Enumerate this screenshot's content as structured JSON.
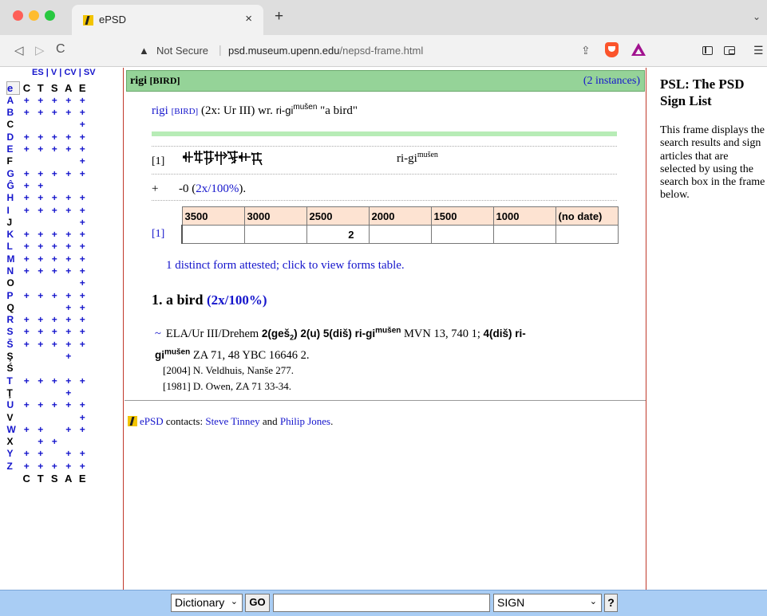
{
  "browser": {
    "tab_title": "ePSD",
    "tab_close": "×",
    "new_tab": "+",
    "tab_menu": "⌄",
    "nav_back": "◁",
    "nav_forward": "▷",
    "nav_reload": "C",
    "security_label": "Not Secure",
    "url_host": "psd.museum.upenn.edu",
    "url_path": "/nepsd-frame.html",
    "colors": {
      "tab_bar": "#dedede",
      "toolbar": "#f2f2f2"
    }
  },
  "index": {
    "head": {
      "es": "ES",
      "v": "V",
      "cv": "CV",
      "sv": "SV",
      "sep": "|"
    },
    "columns": [
      "C",
      "T",
      "S",
      "A",
      "E"
    ],
    "selected": "e",
    "rows": [
      {
        "letter": "A",
        "marks": [
          "+",
          "+",
          "+",
          "+",
          "+"
        ]
      },
      {
        "letter": "B",
        "marks": [
          "+",
          "+",
          "+",
          "+",
          "+"
        ]
      },
      {
        "letter": "C",
        "marks": [
          "",
          "",
          "",
          "",
          "+"
        ]
      },
      {
        "letter": "D",
        "marks": [
          "+",
          "+",
          "+",
          "+",
          "+"
        ]
      },
      {
        "letter": "E",
        "marks": [
          "+",
          "+",
          "+",
          "+",
          "+"
        ]
      },
      {
        "letter": "F",
        "marks": [
          "",
          "",
          "",
          "",
          "+"
        ]
      },
      {
        "letter": "G",
        "marks": [
          "+",
          "+",
          "+",
          "+",
          "+"
        ]
      },
      {
        "letter": "Ĝ",
        "marks": [
          "+",
          "+",
          "",
          "",
          ""
        ]
      },
      {
        "letter": "H",
        "marks": [
          "+",
          "+",
          "+",
          "+",
          "+"
        ]
      },
      {
        "letter": "I",
        "marks": [
          "+",
          "+",
          "+",
          "+",
          "+"
        ]
      },
      {
        "letter": "J",
        "marks": [
          "",
          "",
          "",
          "",
          "+"
        ]
      },
      {
        "letter": "K",
        "marks": [
          "+",
          "+",
          "+",
          "+",
          "+"
        ]
      },
      {
        "letter": "L",
        "marks": [
          "+",
          "+",
          "+",
          "+",
          "+"
        ]
      },
      {
        "letter": "M",
        "marks": [
          "+",
          "+",
          "+",
          "+",
          "+"
        ]
      },
      {
        "letter": "N",
        "marks": [
          "+",
          "+",
          "+",
          "+",
          "+"
        ]
      },
      {
        "letter": "O",
        "marks": [
          "",
          "",
          "",
          "",
          "+"
        ]
      },
      {
        "letter": "P",
        "marks": [
          "+",
          "+",
          "+",
          "+",
          "+"
        ]
      },
      {
        "letter": "Q",
        "marks": [
          "",
          "",
          "",
          "+",
          "+"
        ]
      },
      {
        "letter": "R",
        "marks": [
          "+",
          "+",
          "+",
          "+",
          "+"
        ]
      },
      {
        "letter": "S",
        "marks": [
          "+",
          "+",
          "+",
          "+",
          "+"
        ]
      },
      {
        "letter": "Š",
        "marks": [
          "+",
          "+",
          "+",
          "+",
          "+"
        ]
      },
      {
        "letter": "Ş",
        "marks": [
          "",
          "",
          "",
          "+",
          ""
        ]
      },
      {
        "letter": "Ś",
        "marks": [
          "",
          "",
          "",
          "",
          ""
        ]
      },
      {
        "letter": "T",
        "marks": [
          "+",
          "+",
          "+",
          "+",
          "+"
        ]
      },
      {
        "letter": "Ţ",
        "marks": [
          "",
          "",
          "",
          "+",
          ""
        ]
      },
      {
        "letter": "U",
        "marks": [
          "+",
          "+",
          "+",
          "+",
          "+"
        ]
      },
      {
        "letter": "V",
        "marks": [
          "",
          "",
          "",
          "",
          "+"
        ]
      },
      {
        "letter": "W",
        "marks": [
          "+",
          "+",
          "",
          "+",
          "+"
        ]
      },
      {
        "letter": "X",
        "marks": [
          "",
          "+",
          "+",
          "",
          ""
        ]
      },
      {
        "letter": "Y",
        "marks": [
          "+",
          "+",
          "",
          "+",
          "+"
        ]
      },
      {
        "letter": "Z",
        "marks": [
          "+",
          "+",
          "+",
          "+",
          "+"
        ]
      }
    ],
    "plain_letters": [
      "C",
      "F",
      "J",
      "O",
      "Q",
      "Ş",
      "Ś",
      "Ţ",
      "V",
      "X"
    ],
    "colors": {
      "link": "#1515cc",
      "frame_border": "#c0392b"
    }
  },
  "entry": {
    "title_word": "rigi",
    "title_gloss": "[BIRD]",
    "instances": "(2 instances)",
    "summary_word": "rigi",
    "summary_gloss": "[BIRD]",
    "summary_mid": " (2x: Ur III) wr. ",
    "summary_form": "ri-gi",
    "summary_form_sup": "mušen",
    "summary_meaning": " \"a bird\"",
    "form_index": "[1]",
    "form_translit": "ri-gi",
    "form_translit_sup": "mušen",
    "plus_sign": "+",
    "plus_prefix": "-0 (",
    "plus_link": "2x/100%",
    "plus_suffix": ").",
    "table": {
      "headers": [
        "3500",
        "3000",
        "2500",
        "2000",
        "1500",
        "1000",
        "(no date)"
      ],
      "row_label": "[1]",
      "row_values": [
        "",
        "",
        "2",
        "",
        "",
        "",
        ""
      ]
    },
    "forms_link": "1 distinct form attested; click to view forms table.",
    "sense_label": "1. a bird",
    "sense_stats": "(2x/100%)",
    "citation": {
      "tilde": "~",
      "source": "ELA/Ur III/Drehem ",
      "b1": "2(geš",
      "b1_sub": "2",
      "b1_end": ") 2(u) 5(diš) ri-gi",
      "b1_sup": "mušen",
      "ref1": " MVN 13, 740 1; ",
      "b2a": "4(diš) ri-",
      "b2b": "gi",
      "b2_sup": "mušen",
      "ref2": " ZA 71, 48 YBC 16646 2."
    },
    "bib1": "[2004] N. Veldhuis, Nanše 277.",
    "bib2": "[1981] D. Owen, ZA 71 33-34.",
    "contacts": {
      "epsd": "ePSD",
      "label": " contacts: ",
      "person1": "Steve Tinney",
      "and": " and ",
      "person2": "Philip Jones",
      "end": "."
    },
    "colors": {
      "title_bar": "#95d398",
      "green_rule": "#b7ecb6",
      "table_header": "#fde3d2"
    }
  },
  "info": {
    "title": "PSL: The PSD Sign List",
    "description": "This frame displays the search results and sign articles that are selected by using the search box in the frame below."
  },
  "search": {
    "dictionary_select": "Dictionary",
    "go_label": "GO",
    "query": "",
    "sign_select": "SIGN",
    "help_label": "?",
    "colors": {
      "background": "#a9cdf4"
    }
  }
}
